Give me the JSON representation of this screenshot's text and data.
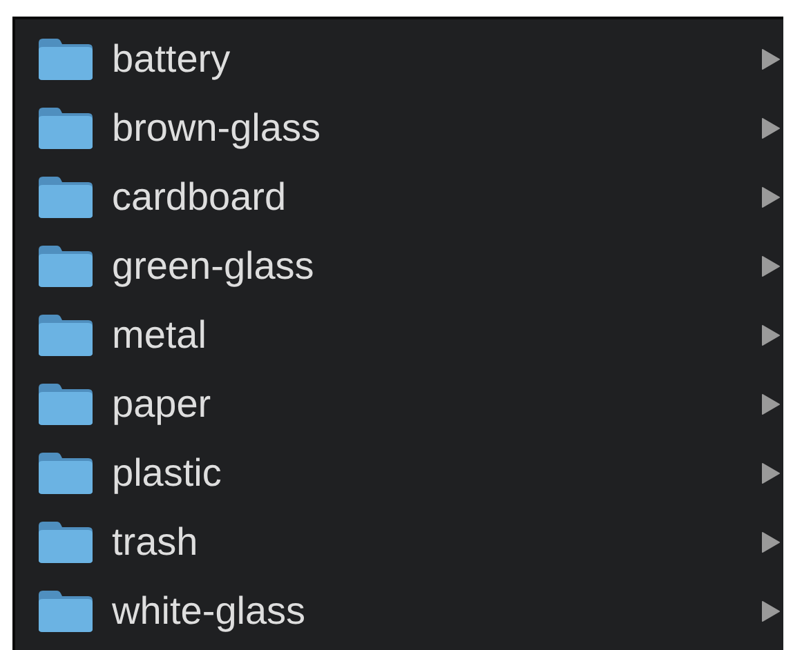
{
  "folders": [
    {
      "name": "battery"
    },
    {
      "name": "brown-glass"
    },
    {
      "name": "cardboard"
    },
    {
      "name": "green-glass"
    },
    {
      "name": "metal"
    },
    {
      "name": "paper"
    },
    {
      "name": "plastic"
    },
    {
      "name": "trash"
    },
    {
      "name": "white-glass"
    }
  ]
}
